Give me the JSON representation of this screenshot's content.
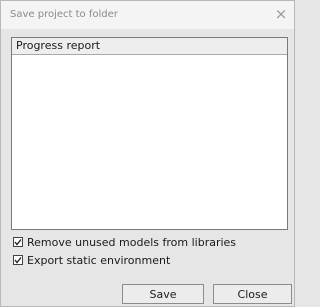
{
  "window": {
    "title": "Save project to folder",
    "close_icon": "close-icon",
    "close_glyph": "×"
  },
  "progress": {
    "header": "Progress report",
    "content": ""
  },
  "options": [
    {
      "label": "Remove unused models from libraries",
      "checked": true
    },
    {
      "label": "Export static environment",
      "checked": true
    }
  ],
  "buttons": {
    "save_label": "Save",
    "close_label": "Close"
  },
  "colors": {
    "background": "#e6e6e6",
    "title_text": "#8a8a8a",
    "panel_background": "#ffffff"
  }
}
